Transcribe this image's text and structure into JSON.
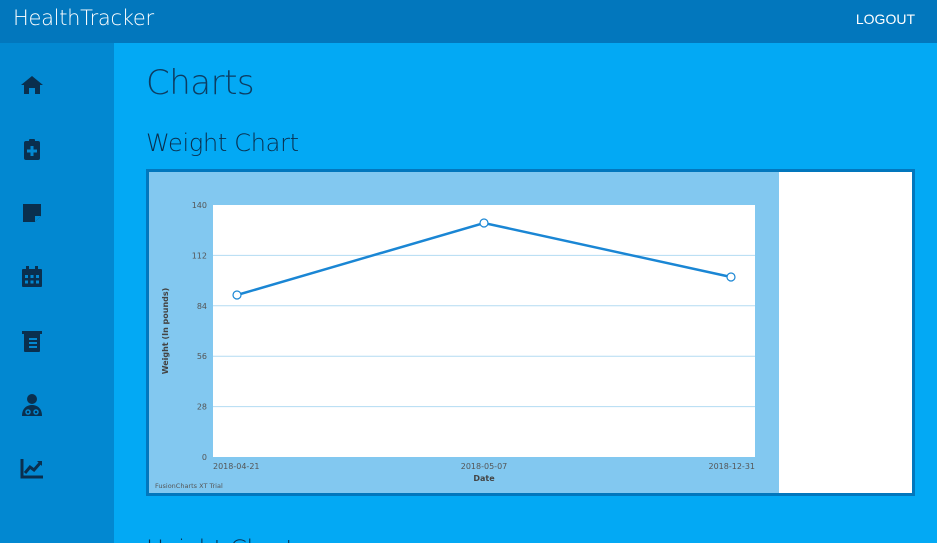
{
  "app": {
    "title": "HealthTracker",
    "logout_label": "LOGOUT"
  },
  "sidebar": {
    "items": [
      {
        "icon": "home-icon"
      },
      {
        "icon": "clipboard-plus-icon"
      },
      {
        "icon": "sticky-note-icon"
      },
      {
        "icon": "calendar-icon"
      },
      {
        "icon": "document-icon"
      },
      {
        "icon": "doctor-icon"
      },
      {
        "icon": "line-chart-icon"
      }
    ]
  },
  "main": {
    "page_title": "Charts",
    "sections": [
      {
        "title": "Weight Chart"
      },
      {
        "title": "Height Chart"
      }
    ]
  },
  "colors": {
    "topbar": "#0277bd",
    "sidebar": "#0288d1",
    "main_bg": "#03a9f4",
    "chart_canvas": "#82c8f0",
    "series_line": "#1a86d4"
  },
  "chart_data": {
    "type": "line",
    "x": [
      "2018-04-21",
      "2018-05-07",
      "2018-12-31"
    ],
    "series": [
      {
        "values": [
          90,
          130,
          100
        ]
      }
    ],
    "xlabel": "Date",
    "ylabel": "Weight (In pounds)",
    "ylim": [
      0,
      140
    ],
    "yticks": [
      0,
      28,
      56,
      84,
      112,
      140
    ],
    "grid": true,
    "watermark": "FusionCharts XT Trial"
  }
}
